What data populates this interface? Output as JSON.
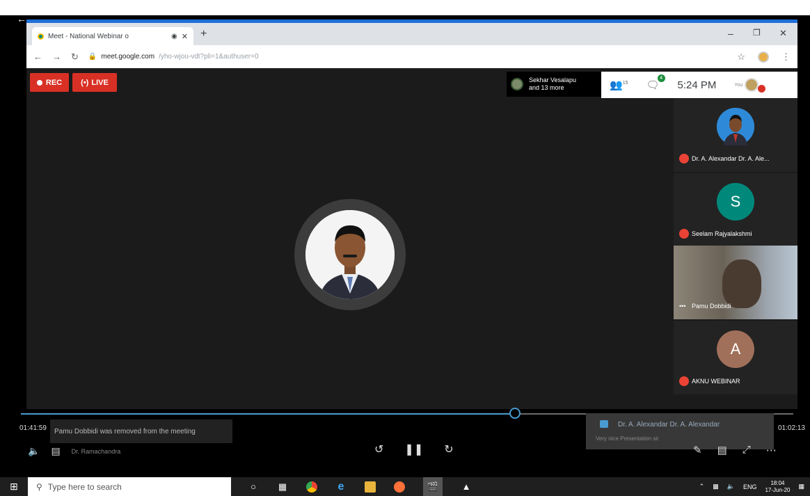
{
  "browser": {
    "tab_title": "Meet - National Webinar o",
    "tab_extra": "◉",
    "url_host": "meet.google.com",
    "url_path": "/yho-wjou-vdt?pli=1&authuser=0"
  },
  "meet": {
    "rec_label": "REC",
    "live_label": "LIVE",
    "presenter_name": "Sekhar Vesalapu",
    "presenter_more": "and 13 more",
    "people_count": "15",
    "chat_badge": "4",
    "clock": "5:24 PM",
    "you_label": "You"
  },
  "participants": [
    {
      "name": "Dr. A. Alexandar Dr. A. Ale...",
      "initial": "",
      "color": "#1a73e8"
    },
    {
      "name": "Seelam Rajyalakshmi",
      "initial": "S",
      "color": "#00897b"
    },
    {
      "name": "Pamu Dobbidi",
      "initial": "",
      "color": ""
    },
    {
      "name": "AKNU WEBINAR",
      "initial": "A",
      "color": "#a1705a"
    }
  ],
  "player": {
    "elapsed": "01:41:59",
    "total": "01:02:13",
    "progress": 0.64,
    "toast": "Pamu Dobbidi was removed from the meeting",
    "chat_sender": "Dr. A. Alexandar Dr. A. Alexandar",
    "chat_message": "Very nice Presentation sir",
    "name_under": "Dr. Ramachandra"
  },
  "taskbar": {
    "search_placeholder": "Type here to search",
    "lang": "ENG",
    "time": "18:04",
    "date": "17-Jun-20"
  }
}
